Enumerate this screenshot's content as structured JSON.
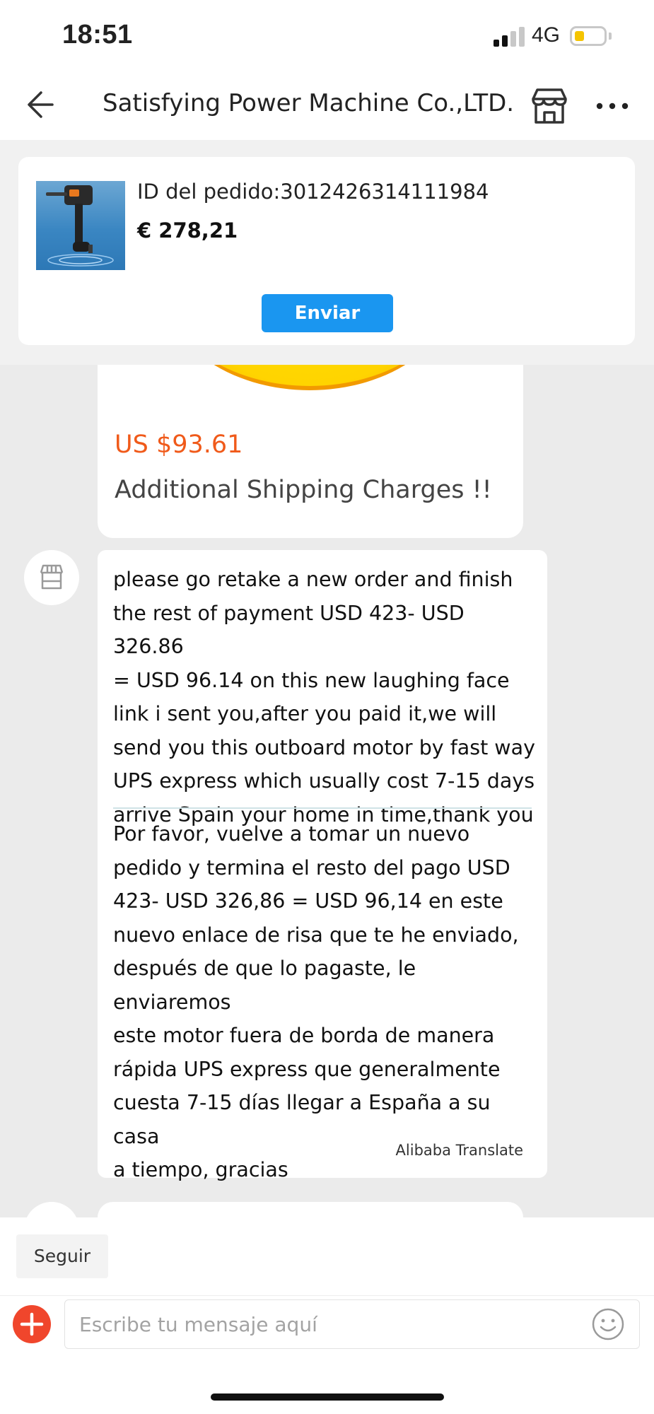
{
  "status_bar": {
    "time": "18:51",
    "network": "4G",
    "battery_level": 0.35,
    "icons": [
      "signal-icon",
      "battery-icon"
    ]
  },
  "nav": {
    "title": "Satisfying Power Machine Co.,LTD.",
    "icons": [
      "back-arrow-icon",
      "store-icon",
      "more-icon"
    ]
  },
  "order": {
    "id_text": "ID del pedido:3012426314111984",
    "price": "€ 278,21",
    "send_label": "Enviar"
  },
  "chat": {
    "previous": {
      "price": "US $93.61",
      "caption": "Additional Shipping Charges !!"
    },
    "message": {
      "original": "please go retake a new order and finish\nthe rest of payment USD 423- USD 326.86\n= USD 96.14 on this new laughing face\nlink i sent you,after you paid it,we will\nsend you this outboard motor by fast way\nUPS express which usually cost 7-15 days\narrive Spain your home in time,thank you",
      "translated": "Por favor, vuelve a tomar un nuevo\npedido y termina el resto del pago USD\n423- USD 326,86 = USD 96,14 en este\nnuevo enlace de risa que te he enviado,\ndespués de que lo pagaste, le enviaremos\neste motor fuera de borda de manera\nrápida UPS express que generalmente\ncuesta 7-15 días llegar a España a su casa\na tiempo, gracias",
      "translator": "Alibaba Translate"
    }
  },
  "bottom": {
    "follow_label": "Seguir",
    "input_placeholder": "Escribe tu mensaje aquí",
    "input_value": "",
    "icons": [
      "plus-icon",
      "emoji-icon"
    ]
  },
  "colors": {
    "accent_blue": "#1a96f0",
    "price_orange": "#f05a1a",
    "add_red": "#f0462c",
    "battery_yellow": "#f5c400"
  }
}
